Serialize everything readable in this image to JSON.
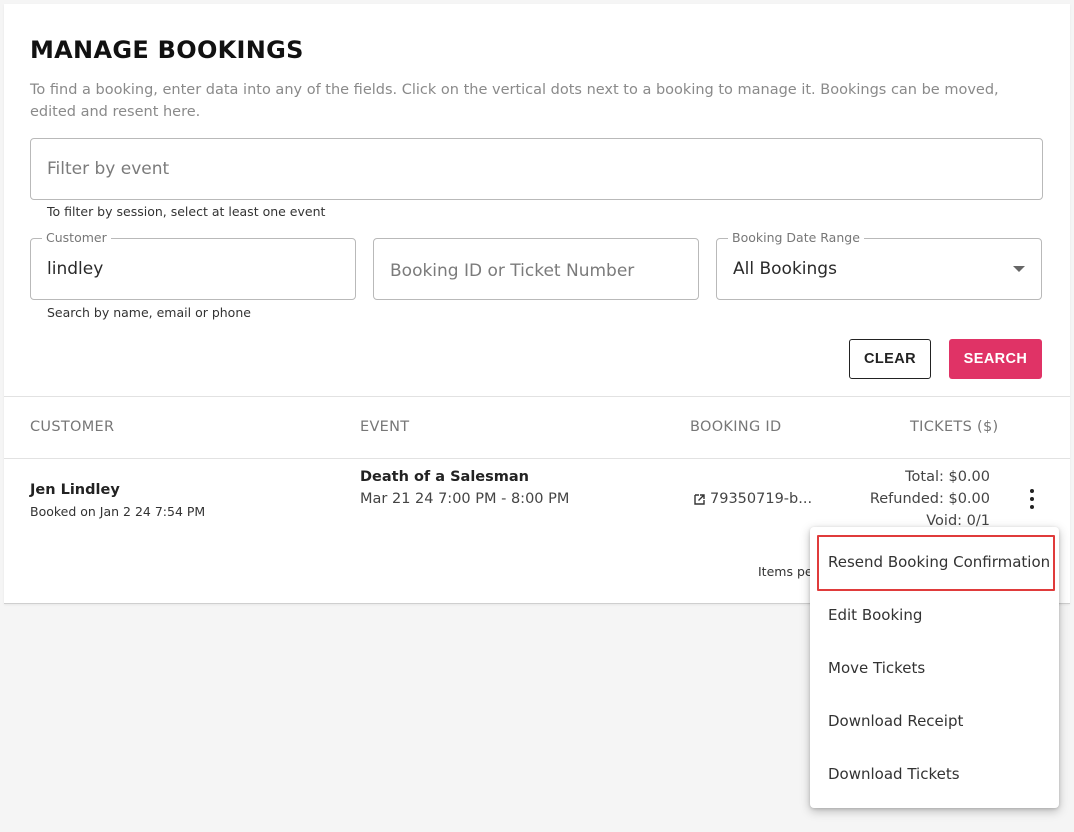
{
  "page": {
    "title": "MANAGE BOOKINGS",
    "description": "To find a booking, enter data into any of the fields. Click on the vertical dots next to a booking to manage it. Bookings can be moved, edited and resent here."
  },
  "filters": {
    "event_placeholder": "Filter by event",
    "event_hint": "To filter by session, select at least one event",
    "customer_label": "Customer",
    "customer_value": "lindley",
    "customer_hint": "Search by name, email or phone",
    "booking_id_placeholder": "Booking ID or Ticket Number",
    "date_range_label": "Booking Date Range",
    "date_range_value": "All Bookings",
    "clear_label": "CLEAR",
    "search_label": "SEARCH"
  },
  "table": {
    "headers": [
      "CUSTOMER",
      "EVENT",
      "BOOKING ID",
      "TICKETS ($)"
    ],
    "rows": [
      {
        "customer_name": "Jen Lindley",
        "booked_on": "Booked on Jan 2 24 7:54 PM",
        "event_name": "Death of a Salesman",
        "event_time": "Mar 21 24 7:00 PM - 8:00 PM",
        "booking_id": "79350719-b...",
        "total": "Total: $0.00",
        "refunded": "Refunded: $0.00",
        "void": "Void: 0/1"
      }
    ],
    "footer_text": "Items pe"
  },
  "menu": {
    "items": [
      "Resend Booking Confirmation",
      "Edit Booking",
      "Move Tickets",
      "Download Receipt",
      "Download Tickets"
    ]
  },
  "colors": {
    "accent": "#e03366",
    "highlight": "#e03b3b"
  }
}
